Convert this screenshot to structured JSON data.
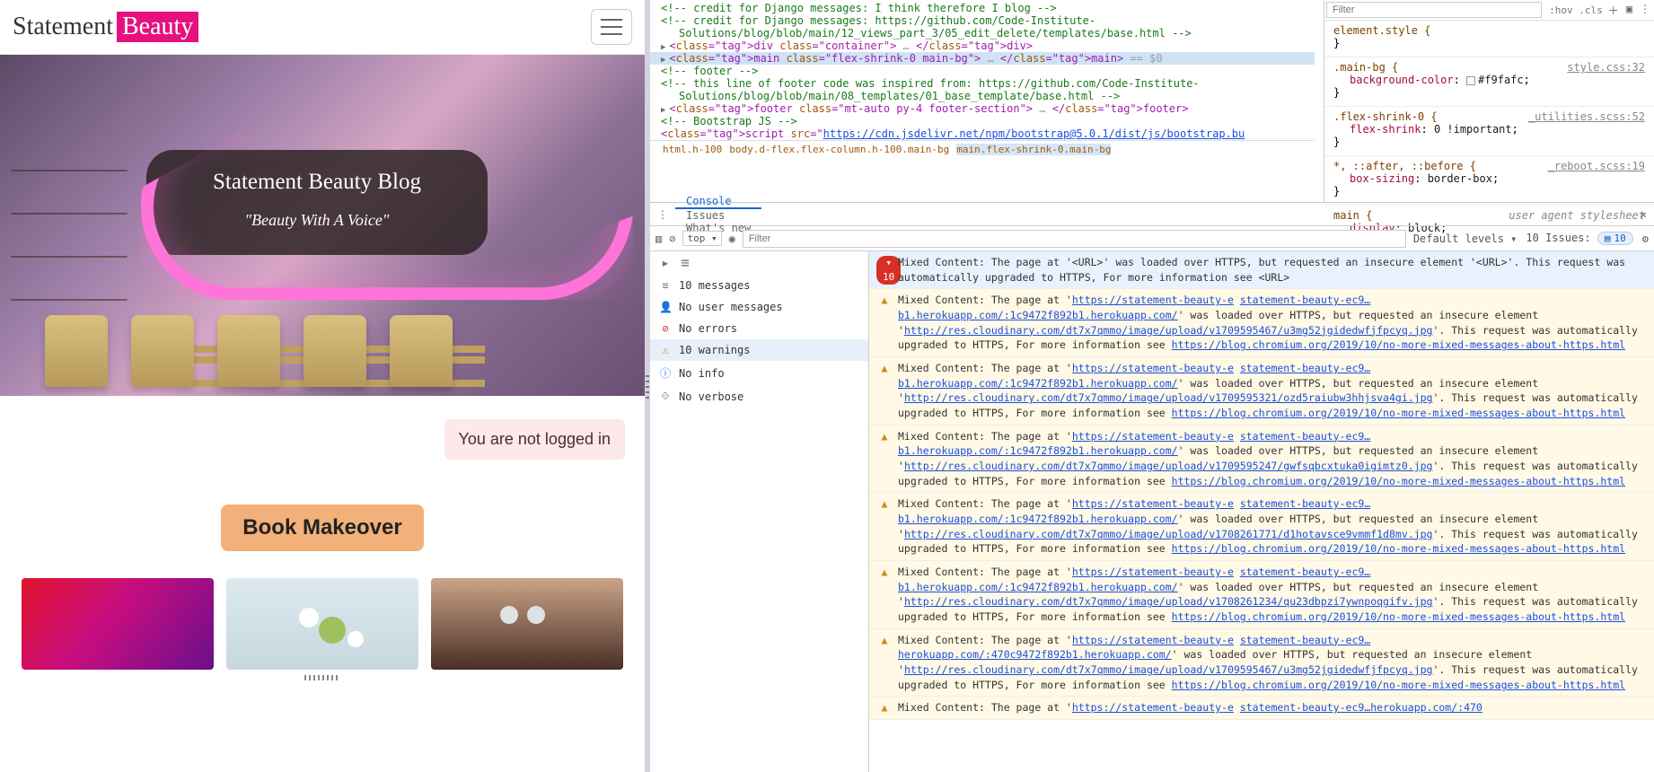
{
  "site": {
    "brand_left": "Statement",
    "brand_right": "Beauty",
    "hero_title": "Statement Beauty Blog",
    "hero_sub": "\"Beauty With A Voice\"",
    "login_status": "You are not logged in",
    "cta": "Book Makeover"
  },
  "elements": {
    "lines": [
      {
        "cls": "com",
        "txt": "<!-- credit for Django messages: I think therefore I blog -->"
      },
      {
        "cls": "com",
        "txt": "<!-- credit for Django messages: https://github.com/Code-Institute-Solutions/blog/blob/main/12_views_part_3/05_edit_delete/templates/base.html -->"
      },
      {
        "cls": "tag arrow",
        "txt": "<div class=\"container\"> … </div>"
      },
      {
        "cls": "tag arrow sel",
        "txt": "<main class=\"flex-shrink-0 main-bg\"> … </main>  == $0"
      },
      {
        "cls": "com",
        "txt": "<!-- footer -->"
      },
      {
        "cls": "com",
        "txt": "<!-- this line of footer code was inspired from: https://github.com/Code-Institute-Solutions/blog/blob/main/08_templates/01_base_template/base.html -->"
      },
      {
        "cls": "tag arrow",
        "txt": "<footer class=\"mt-auto py-4 footer-section\"> … </footer>"
      },
      {
        "cls": "com",
        "txt": "<!-- Bootstrap JS -->"
      },
      {
        "cls": "tag",
        "txt": "<script src=\"https://cdn.jsdelivr.net/npm/bootstrap@5.0.1/dist/js/bootstrap.bu"
      }
    ],
    "breadcrumbs": [
      "html.h-100",
      "body.d-flex.flex-column.h-100.main-bg",
      "main.flex-shrink-0.main-bg"
    ],
    "breadcrumb_selected": 2
  },
  "styles": {
    "filter_placeholder": "Filter",
    "hint": ":hov .cls",
    "rules": [
      {
        "selector": "element.style {",
        "decl": "",
        "src": ""
      },
      {
        "selector": ".main-bg {",
        "decl": "background-color: #f9fafc;",
        "src": "style.css:32"
      },
      {
        "selector": ".flex-shrink-0 {",
        "decl": "flex-shrink: 0 !important;",
        "src": "_utilities.scss:52"
      },
      {
        "selector": "*, ::after, ::before {",
        "decl": "box-sizing: border-box;",
        "src": "_reboot.scss:19"
      },
      {
        "selector": "main {",
        "decl": "display: block;",
        "src": "user agent stylesheet"
      }
    ]
  },
  "tabs": {
    "items": [
      "Console",
      "Issues",
      "What's new"
    ],
    "active_index": 0
  },
  "toolbar": {
    "context": "top ▾",
    "filter_placeholder": "Filter",
    "levels": "Default levels ▾",
    "issues": "10 Issues:",
    "issue_count": "10"
  },
  "sidebar": [
    {
      "icon": "≡",
      "cls": "uc-grey",
      "label": "10 messages"
    },
    {
      "icon": "👤",
      "cls": "uc-grey",
      "label": "No user messages"
    },
    {
      "icon": "⊘",
      "cls": "uc-red",
      "label": "No errors"
    },
    {
      "icon": "⚠",
      "cls": "uc-orange",
      "label": "10 warnings",
      "sel": true
    },
    {
      "icon": "ⓘ",
      "cls": "uc-blue",
      "label": "No info"
    },
    {
      "icon": "⟐",
      "cls": "uc-grey",
      "label": "No verbose"
    }
  ],
  "messages": {
    "header_count": "10",
    "header": "Mixed Content: The page at '<URL>' was loaded over HTTPS, but requested an insecure element '<URL>'. This request was automatically upgraded to HTTPS, For more information see <URL>",
    "link_host1": "https://statement-beauty-e",
    "link_host2": "statement-beauty-ec9…b1.herokuapp.com/:1",
    "link_from": "c9472f892b1.herokuapp.com/",
    "more_info": "https://blog.chromium.org/2019/10/no-more-mixed-messages-about-https.html",
    "items": [
      {
        "res": "http://res.cloudinary.com/dt7x7qmmo/image/upload/v1709595467/u3mg52jgidedwfjfpcyq.jpg"
      },
      {
        "res": "http://res.cloudinary.com/dt7x7qmmo/image/upload/v1709595321/ozd5raiubw3hhjsva4gi.jpg"
      },
      {
        "res": "http://res.cloudinary.com/dt7x7qmmo/image/upload/v1709595247/gwfsqbcxtuka0igimtz0.jpg"
      },
      {
        "res": "http://res.cloudinary.com/dt7x7qmmo/image/upload/v1708261771/d1hotavsce9vmmf1d8mv.jpg"
      },
      {
        "res": "http://res.cloudinary.com/dt7x7qmmo/image/upload/v1708261234/qu23dbpzi7ywnpoqgifv.jpg"
      },
      {
        "res": "http://res.cloudinary.com/dt7x7qmmo/image/upload/v1709595467/u3mg52jgidedwfjfpcyq.jpg",
        "host2": "statement-beauty-ec9…herokuapp.com/:470",
        "from": "c9472f892b1.herokuapp.com/"
      }
    ],
    "trailing_host2": "statement-beauty-ec9…herokuapp.com/:470"
  }
}
